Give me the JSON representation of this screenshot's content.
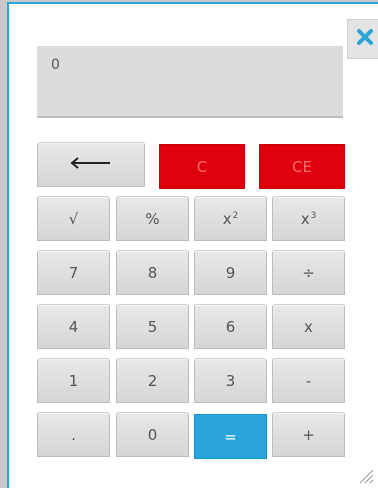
{
  "display": {
    "value": "0"
  },
  "close": {
    "icon": "close-icon",
    "color": "#2aa5d6"
  },
  "keys": {
    "backspace": {
      "icon": "backspace-arrow-icon"
    },
    "clear": "C",
    "clear_entry": "CE",
    "sqrt": "√",
    "percent": "%",
    "square_base": "x",
    "square_exp": "2",
    "cube_base": "x",
    "cube_exp": "3",
    "seven": "7",
    "eight": "8",
    "nine": "9",
    "divide": "÷",
    "four": "4",
    "five": "5",
    "six": "6",
    "multiply": "x",
    "one": "1",
    "two": "2",
    "three": "3",
    "minus": "-",
    "decimal": ".",
    "zero": "0",
    "equals": "=",
    "plus": "+"
  },
  "colors": {
    "clear_bg": "#e0000d",
    "equals_bg": "#2aa5dc",
    "frame_border": "#2aa5d6"
  }
}
